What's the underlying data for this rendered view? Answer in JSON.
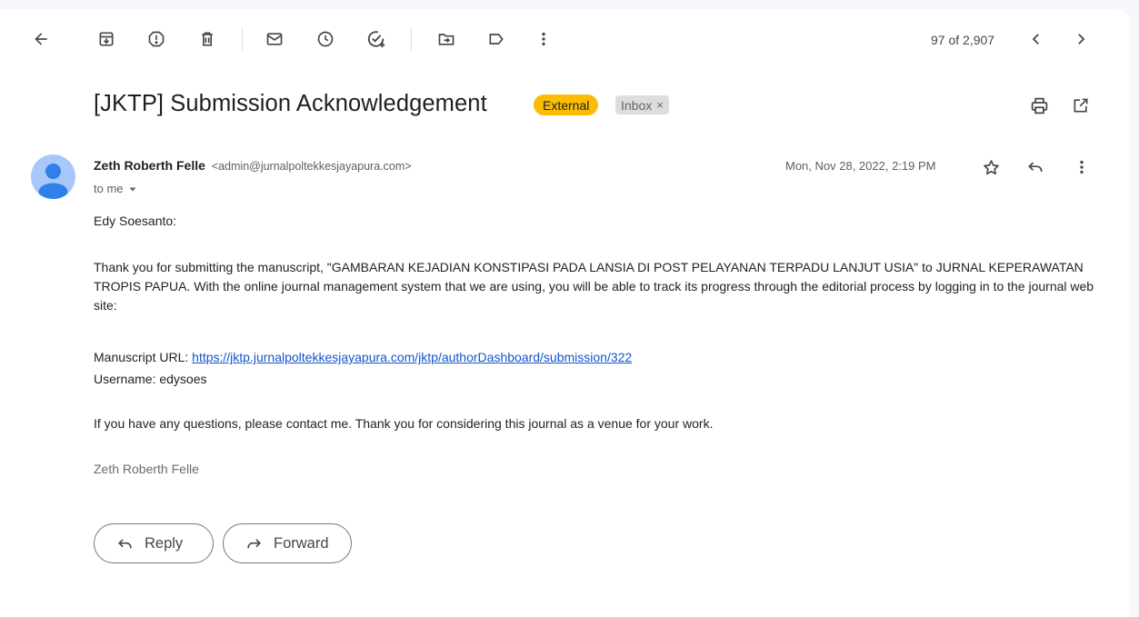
{
  "toolbar": {
    "counter": "97 of 2,907"
  },
  "subject": "[JKTP] Submission Acknowledgement",
  "labels": {
    "external": "External",
    "inbox": "Inbox",
    "inbox_remove": "×"
  },
  "message": {
    "sender_name": "Zeth Roberth Felle",
    "sender_email": "<admin@jurnalpoltekkesjayapura.com>",
    "to_me": "to me",
    "date": "Mon, Nov 28, 2022, 2:19 PM",
    "body": {
      "greeting": "Edy Soesanto:",
      "thanks": "Thank you for submitting the manuscript, \"GAMBARAN KEJADIAN KONSTIPASI PADA LANSIA DI POST PELAYANAN TERPADU LANJUT USIA\" to JURNAL KEPERAWATAN TROPIS PAPUA. With the online journal management system that we are using, you will be able to track its progress through the editorial process by logging in to the journal web site:",
      "url_label": "Manuscript URL: ",
      "url": "https://jktp.jurnalpoltekkesjayapura.com/jktp/authorDashboard/submission/322",
      "username": "Username: edysoes",
      "questions": "If you have any questions, please contact me. Thank you for considering this journal as a venue for your work.",
      "signature": "Zeth Roberth Felle"
    }
  },
  "actions": {
    "reply": "Reply",
    "forward": "Forward"
  },
  "icons": {
    "back": "arrow-left-icon",
    "archive": "archive-icon",
    "spam": "report-spam-icon",
    "delete": "trash-icon",
    "unread": "mail-icon",
    "snooze": "clock-icon",
    "task": "add-task-icon",
    "move": "move-to-folder-icon",
    "label": "label-icon",
    "more": "more-vert-icon",
    "prev": "chevron-left-icon",
    "next": "chevron-right-icon",
    "print": "printer-icon",
    "new_window": "open-in-new-icon",
    "star": "star-icon",
    "reply": "reply-icon",
    "forward": "forward-icon"
  },
  "colors": {
    "external_chip": "#fbbc04",
    "inbox_chip": "#dddddd",
    "link": "#1155cc",
    "avatar": "#a8c7fa"
  }
}
